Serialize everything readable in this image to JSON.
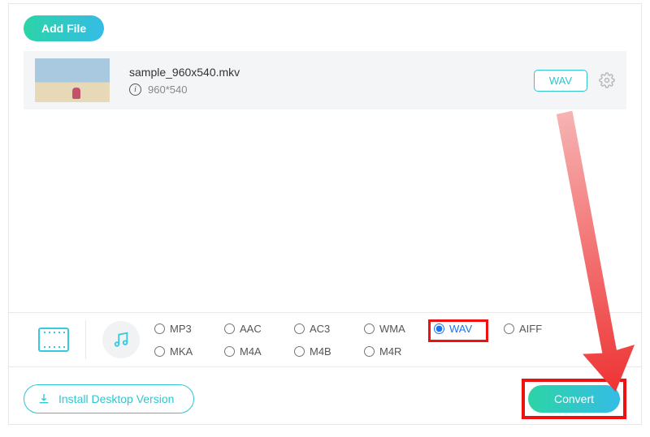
{
  "buttons": {
    "add_file": "Add File",
    "install": "Install Desktop Version",
    "convert": "Convert"
  },
  "file": {
    "name": "sample_960x540.mkv",
    "dimensions": "960*540",
    "output_format_badge": "WAV"
  },
  "format_groups": {
    "video_icon": "video-icon",
    "audio_icon": "music-icon"
  },
  "audio_formats": {
    "row1": [
      "MP3",
      "AAC",
      "AC3",
      "WMA",
      "WAV",
      "AIFF"
    ],
    "row2": [
      "MKA",
      "M4A",
      "M4B",
      "M4R"
    ]
  },
  "selected_format": "WAV"
}
